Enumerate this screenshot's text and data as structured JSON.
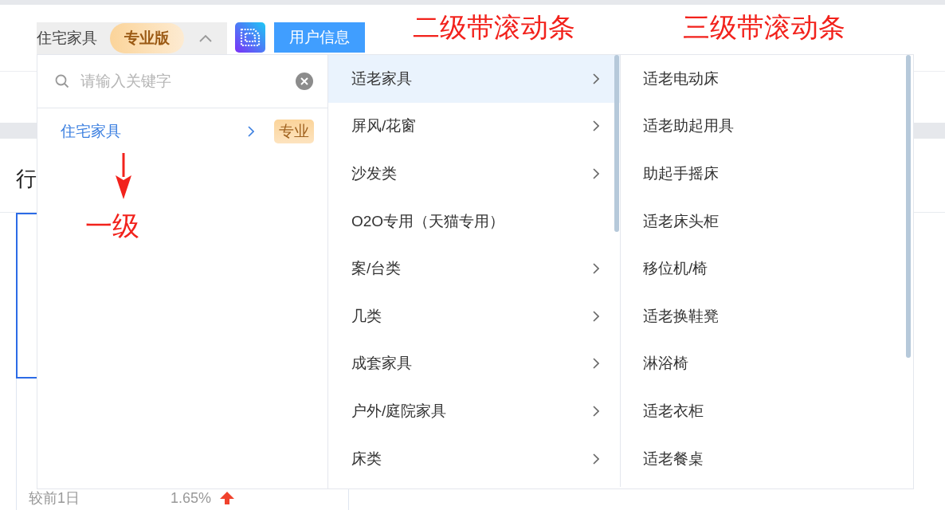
{
  "header": {
    "selector": {
      "value": "住宅家具",
      "badge": "专业版",
      "expanded": true
    },
    "user_info_button": "用户信息"
  },
  "background": {
    "section_title": "行",
    "compare_label": "较前1日",
    "compare_value": "1.65%"
  },
  "cascader": {
    "search": {
      "placeholder": "请输入关键字"
    },
    "level1": [
      {
        "label": "住宅家具",
        "tag": "专业",
        "selected": true,
        "has_children": true
      }
    ],
    "level2": [
      {
        "label": "适老家具",
        "selected": true,
        "has_children": true
      },
      {
        "label": "屏风/花窗",
        "selected": false,
        "has_children": true
      },
      {
        "label": "沙发类",
        "selected": false,
        "has_children": true
      },
      {
        "label": "O2O专用（天猫专用）",
        "selected": false,
        "has_children": false
      },
      {
        "label": "案/台类",
        "selected": false,
        "has_children": true
      },
      {
        "label": "几类",
        "selected": false,
        "has_children": true
      },
      {
        "label": "成套家具",
        "selected": false,
        "has_children": true
      },
      {
        "label": "户外/庭院家具",
        "selected": false,
        "has_children": true
      },
      {
        "label": "床类",
        "selected": false,
        "has_children": true
      }
    ],
    "level3": [
      {
        "label": "适老电动床",
        "selected": false
      },
      {
        "label": "适老助起用具",
        "selected": false
      },
      {
        "label": "助起手摇床",
        "selected": false
      },
      {
        "label": "适老床头柜",
        "selected": false
      },
      {
        "label": "移位机/椅",
        "selected": false
      },
      {
        "label": "适老换鞋凳",
        "selected": false
      },
      {
        "label": "淋浴椅",
        "selected": false
      },
      {
        "label": "适老衣柜",
        "selected": false
      },
      {
        "label": "适老餐桌",
        "selected": false
      }
    ]
  },
  "annotations": [
    {
      "text": "二级带滚动条"
    },
    {
      "text": "三级带滚动条"
    },
    {
      "text": "一级"
    }
  ]
}
